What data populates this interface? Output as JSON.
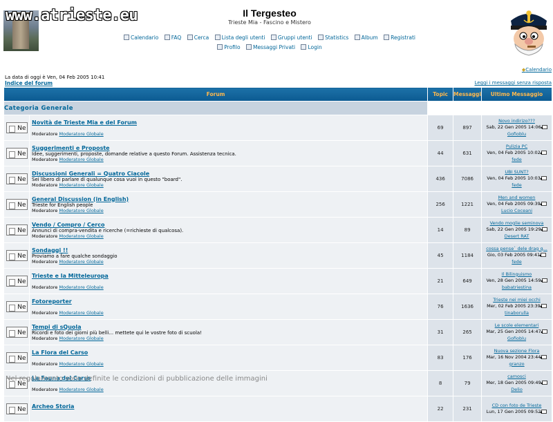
{
  "header": {
    "site_url": "www.atrieste.eu",
    "title": "Il Tergesteo",
    "subtitle": "Trieste Mia - Fascino e Mistero",
    "nav_row1": [
      {
        "label": "Calendario"
      },
      {
        "label": "FAQ"
      },
      {
        "label": "Cerca"
      },
      {
        "label": "Lista degli utenti"
      },
      {
        "label": "Gruppi utenti"
      },
      {
        "label": "Statistics"
      },
      {
        "label": "Album"
      },
      {
        "label": "Registrati"
      }
    ],
    "nav_row2": [
      {
        "label": "Profilo"
      },
      {
        "label": "Messaggi Privati"
      },
      {
        "label": "Login"
      }
    ],
    "calendar_link": "Calendario"
  },
  "date_line": "La data di oggi è Ven, 04 Feb 2005 10:41",
  "index_link": "Indice del forum",
  "unread_link": "Leggi i messaggi senza risposta",
  "table": {
    "headers": {
      "forum": "Forum",
      "topics": "Topic",
      "posts": "Messaggi",
      "last": "Ultimo Messaggio"
    },
    "category": "Categoria Generale",
    "moderator_label": "Moderatore",
    "folder_label": "Ne",
    "rows": [
      {
        "name": "Novità  de Trieste Mia e del Forum",
        "desc": "",
        "mod": "Moderatore Globale",
        "topics": "69",
        "posts": "897",
        "lp_topic": "Novo indirizo???",
        "lp_date": "Sab, 22 Gen 2005 14:06",
        "lp_user": "Gofioblu"
      },
      {
        "name": "Suggerimenti e Proposte",
        "desc": "Idee, suggerimenti, proposte, domande relative a questo Forum. Assistenza tecnica.",
        "mod": "Moderatore Globale",
        "topics": "44",
        "posts": "631",
        "lp_topic": "Pulizia PC",
        "lp_date": "Ven, 04 Feb 2005 10:02",
        "lp_user": "fede"
      },
      {
        "name": "Discussioni Generali = Quatro Ciacole",
        "desc": "Sei libero di parlare di qualunque cosa vuoi in questo \"board\".",
        "mod": "Moderatore Globale",
        "topics": "436",
        "posts": "7086",
        "lp_topic": "UBI SUNT?",
        "lp_date": "Ven, 04 Feb 2005 10:03",
        "lp_user": "fede"
      },
      {
        "name": "General Discussion (in English)",
        "desc": "Trieste for English people",
        "mod": "Moderatore Globale",
        "topics": "256",
        "posts": "1221",
        "lp_topic": "Men and women",
        "lp_date": "Ven, 04 Feb 2005 09:39",
        "lp_user": "Lucio Coceani"
      },
      {
        "name": "Vendo / Compro / Cerco",
        "desc": "Annunci di compra-vendita e ricerche (=richieste di qualcosa).",
        "mod": "Moderatore Globale",
        "topics": "14",
        "posts": "89",
        "lp_topic": "Vendo moglie seminova",
        "lp_date": "Sab, 22 Gen 2005 19:29",
        "lp_user": "Desert RAT"
      },
      {
        "name": "Sondaggi !!",
        "desc": "Proviamo a fare qualche sondaggio",
        "mod": "Moderatore Globale",
        "topics": "45",
        "posts": "1184",
        "lp_topic": "cossa pense` dele drag q...",
        "lp_date": "Gio, 03 Feb 2005 09:41",
        "lp_user": "fede"
      },
      {
        "name": "Trieste e la Mitteleuropa",
        "desc": "",
        "mod": "Moderatore Globale",
        "topics": "21",
        "posts": "649",
        "lp_topic": "Il Bilinguismo",
        "lp_date": "Ven, 28 Gen 2005 14:59",
        "lp_user": "babatriestina"
      },
      {
        "name": "Fotoreporter",
        "desc": "",
        "mod": "Moderatore Globale",
        "topics": "76",
        "posts": "1636",
        "lp_topic": "Trieste nei miei occhi",
        "lp_date": "Mer, 02 Feb 2005 23:39",
        "lp_user": "tinaborulla"
      },
      {
        "name": "Tempi di sQuola",
        "desc": "Ricordi e foto dei giorni più belli... mettete qui le vostre foto di scuola!",
        "mod": "Moderatore Globale",
        "topics": "31",
        "posts": "265",
        "lp_topic": "Le scole elementari",
        "lp_date": "Mar, 25 Gen 2005 14:47",
        "lp_user": "Gofioblu"
      },
      {
        "name": "La Flora del Carso",
        "desc": "",
        "mod": "Moderatore Globale",
        "topics": "83",
        "posts": "176",
        "lp_topic": "Nuova sezione Flora",
        "lp_date": "Mar, 16 Nov 2004 23:44",
        "lp_user": "granzo"
      },
      {
        "name": "La Fauna del Carso",
        "desc": "",
        "mod": "Moderatore Globale",
        "topics": "8",
        "posts": "79",
        "lp_topic": "camosci",
        "lp_date": "Mer, 18 Gen 2005 09:49",
        "lp_user": "Delio"
      },
      {
        "name": "Archeo Storia",
        "desc": "",
        "mod": "",
        "topics": "22",
        "posts": "231",
        "lp_topic": "CD con foto de Trieste",
        "lp_date": "Lun, 17 Gen 2005 09:52",
        "lp_user": ""
      }
    ]
  },
  "notice": "Nel regolamento sono definite le condizioni di pubblicazione delle immagini"
}
